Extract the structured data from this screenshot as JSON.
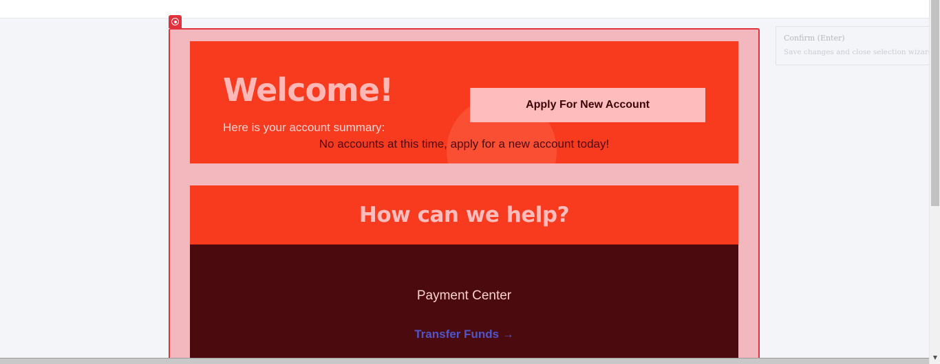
{
  "welcome": {
    "title": "Welcome!",
    "subtitle": "Here is your account summary:",
    "empty_message": "No accounts at this time, apply for a new account today!",
    "apply_button": "Apply For New Account"
  },
  "help": {
    "title": "How can we help?",
    "card_title": "Payment Center",
    "link": "Transfer Funds →"
  },
  "tooltip": {
    "title": "Confirm (Enter)",
    "description": "Save changes and close selection wizard."
  },
  "icons": {
    "selection_handle": "target-icon",
    "scroll_up": "arrow-up-icon",
    "scroll_down": "arrow-down-icon"
  },
  "colors": {
    "brand_primary": "#f83b1f",
    "brand_dark": "#4a0a0e",
    "accent_light": "#ffbcbc",
    "selection_outline": "#e2313d",
    "link": "#5255c9"
  }
}
